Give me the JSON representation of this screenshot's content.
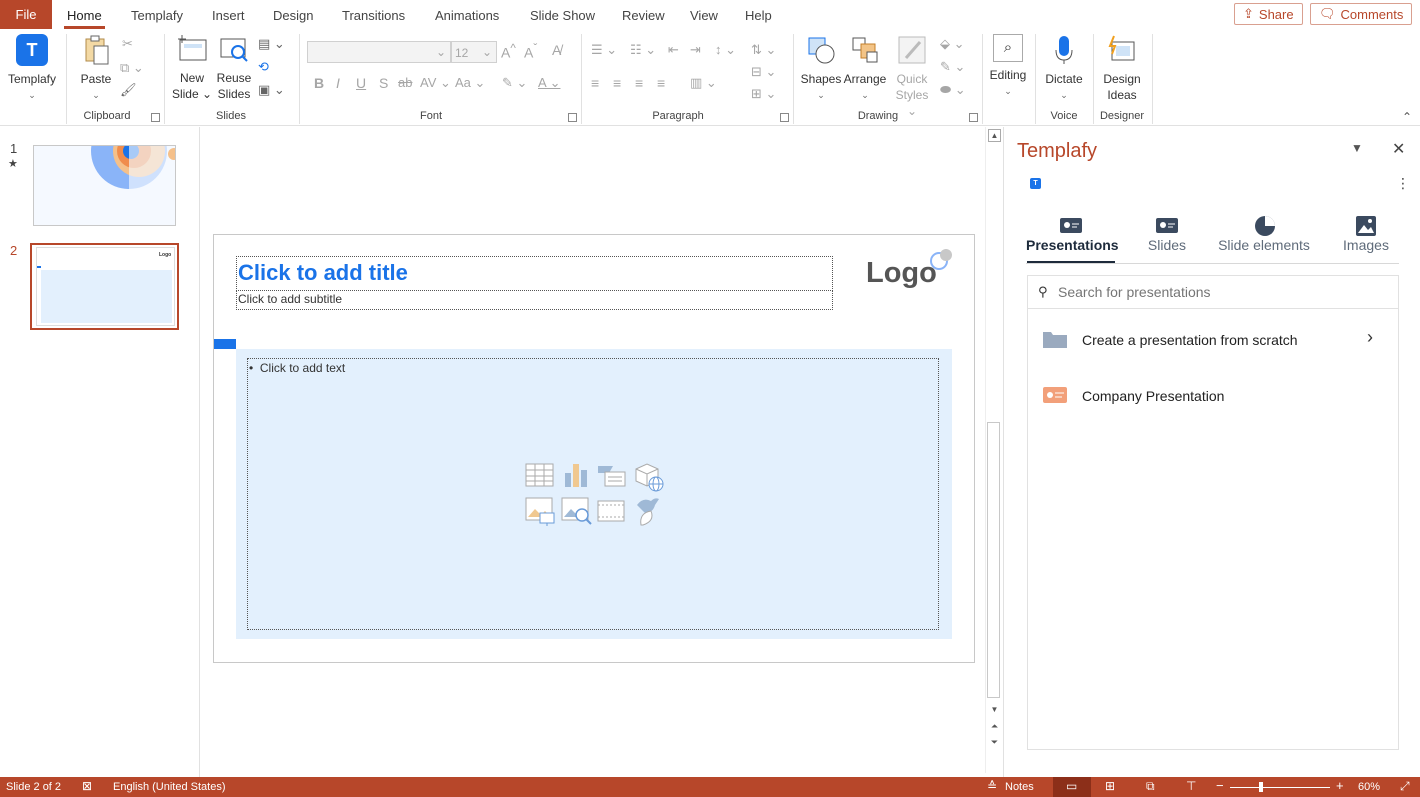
{
  "tabs": {
    "file": "File",
    "items": [
      "Home",
      "Templafy",
      "Insert",
      "Design",
      "Transitions",
      "Animations",
      "Slide Show",
      "Review",
      "View",
      "Help"
    ],
    "active": "Home"
  },
  "header_buttons": {
    "share": "Share",
    "comments": "Comments"
  },
  "ribbon": {
    "templafy": {
      "label": "Templafy"
    },
    "clipboard": {
      "paste": "Paste",
      "group": "Clipboard"
    },
    "slides": {
      "new_slide_1": "New",
      "new_slide_2": "Slide",
      "reuse_1": "Reuse",
      "reuse_2": "Slides",
      "group": "Slides"
    },
    "font": {
      "size": "12",
      "group": "Font"
    },
    "paragraph": {
      "group": "Paragraph"
    },
    "drawing": {
      "shapes": "Shapes",
      "arrange": "Arrange",
      "quick_styles_1": "Quick",
      "quick_styles_2": "Styles",
      "group": "Drawing"
    },
    "editing": {
      "label": "Editing"
    },
    "voice": {
      "dictate": "Dictate",
      "group": "Voice"
    },
    "designer": {
      "design_ideas_1": "Design",
      "design_ideas_2": "Ideas",
      "group": "Designer"
    }
  },
  "thumbnails": [
    {
      "number": "1",
      "marker": "★"
    },
    {
      "number": "2",
      "logo": "Logo"
    }
  ],
  "slide": {
    "title_placeholder": "Click to add title",
    "subtitle_placeholder": "Click to add subtitle",
    "body_placeholder": "Click to add text",
    "logo": "Logo"
  },
  "pane": {
    "title": "Templafy",
    "tabs": [
      "Presentations",
      "Slides",
      "Slide elements",
      "Images"
    ],
    "active_tab": "Presentations",
    "search_placeholder": "Search for presentations",
    "items": [
      {
        "label": "Create a presentation from scratch",
        "icon": "folder-icon"
      },
      {
        "label": "Company Presentation",
        "icon": "presentation-icon"
      }
    ]
  },
  "status": {
    "slide_info": "Slide 2 of 2",
    "language": "English (United States)",
    "notes": "Notes",
    "zoom": "60%"
  },
  "colors": {
    "accent": "#b7472a",
    "title_blue": "#1a73e8",
    "body_fill": "#e3f0fd",
    "pane_title": "#b7472a"
  }
}
